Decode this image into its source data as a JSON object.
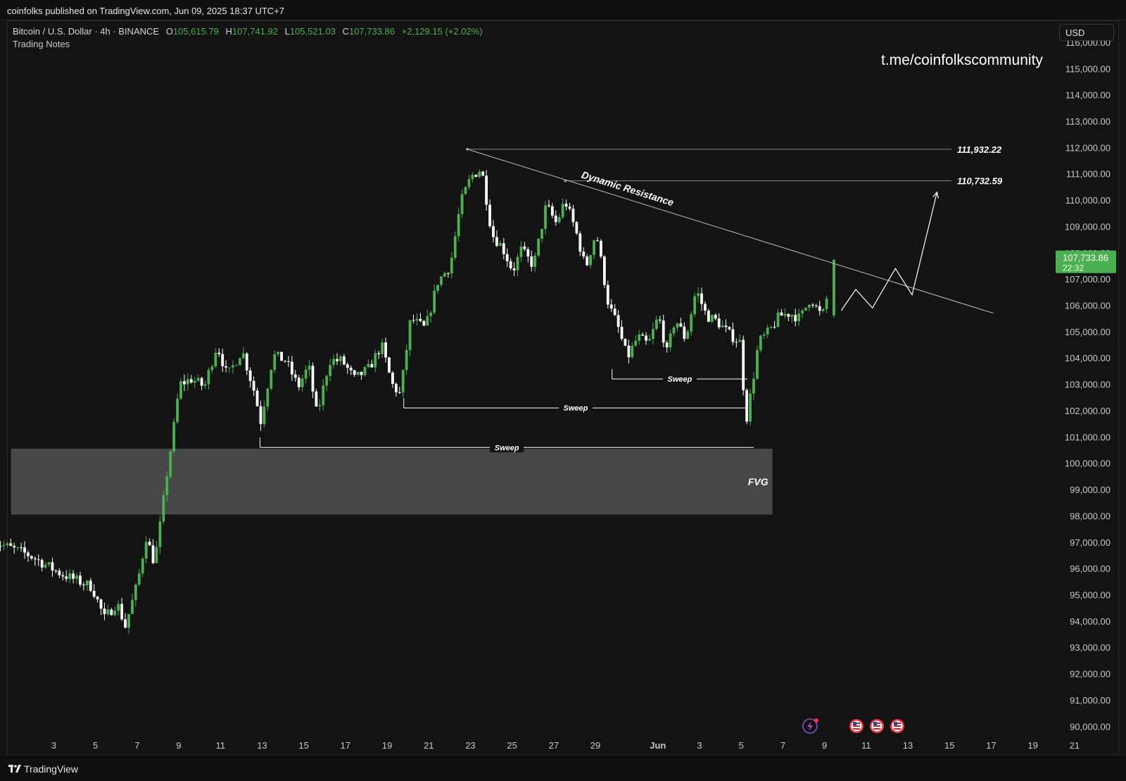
{
  "header": {
    "published": "coinfolks published on TradingView.com, Jun 09, 2025 18:37 UTC+7"
  },
  "legend": {
    "symbol": "Bitcoin / U.S. Dollar · 4h · BINANCE",
    "o_label": "O",
    "o_value": "105,615.79",
    "h_label": "H",
    "h_value": "107,741.92",
    "l_label": "L",
    "l_value": "105,521.03",
    "c_label": "C",
    "c_value": "107,733.86",
    "change": "+2,129.15 (+2.02%)",
    "notes": "Trading Notes"
  },
  "watermark": "t.me/coinfolkscommunity",
  "currency_button": "USD",
  "price_badge": {
    "price": "107,733.86",
    "countdown": "22:32",
    "color": "#4caf50"
  },
  "footer": {
    "brand": "TradingView"
  },
  "colors": {
    "up": "#4caf50",
    "down": "#ffffff",
    "fvg": "#474747",
    "background": "#131313"
  },
  "chart_data": {
    "type": "candlestick",
    "instrument": "Bitcoin / U.S. Dollar",
    "interval": "4h",
    "ylim": [
      89500,
      116800
    ],
    "y_ticks": [
      "116,000.00",
      "115,000.00",
      "114,000.00",
      "113,000.00",
      "112,000.00",
      "111,000.00",
      "110,000.00",
      "109,000.00",
      "108,000.00",
      "107,000.00",
      "106,000.00",
      "105,000.00",
      "104,000.00",
      "103,000.00",
      "102,000.00",
      "101,000.00",
      "100,000.00",
      "99,000.00",
      "98,000.00",
      "97,000.00",
      "96,000.00",
      "95,000.00",
      "94,000.00",
      "93,000.00",
      "92,000.00",
      "91,000.00",
      "90,000.00"
    ],
    "y_tick_values": [
      116000,
      115000,
      114000,
      113000,
      112000,
      111000,
      110000,
      109000,
      108000,
      107000,
      106000,
      105000,
      104000,
      103000,
      102000,
      101000,
      100000,
      99000,
      98000,
      97000,
      96000,
      95000,
      94000,
      93000,
      92000,
      91000,
      90000
    ],
    "x_ticks": [
      {
        "day": 3,
        "label": "3"
      },
      {
        "day": 5,
        "label": "5"
      },
      {
        "day": 7,
        "label": "7"
      },
      {
        "day": 9,
        "label": "9"
      },
      {
        "day": 11,
        "label": "11"
      },
      {
        "day": 13,
        "label": "13"
      },
      {
        "day": 15,
        "label": "15"
      },
      {
        "day": 17,
        "label": "17"
      },
      {
        "day": 19,
        "label": "19"
      },
      {
        "day": 21,
        "label": "21"
      },
      {
        "day": 23,
        "label": "23"
      },
      {
        "day": 25,
        "label": "25"
      },
      {
        "day": 27,
        "label": "27"
      },
      {
        "day": 29,
        "label": "29"
      },
      {
        "day": 32,
        "label": "Jun"
      },
      {
        "day": 34,
        "label": "3"
      },
      {
        "day": 36,
        "label": "5"
      },
      {
        "day": 38,
        "label": "7"
      },
      {
        "day": 40,
        "label": "9"
      },
      {
        "day": 42,
        "label": "11"
      },
      {
        "day": 44,
        "label": "13"
      },
      {
        "day": 46,
        "label": "15"
      },
      {
        "day": 48,
        "label": "17"
      },
      {
        "day": 50,
        "label": "19"
      },
      {
        "day": 52,
        "label": "21"
      }
    ],
    "swing_points": [
      [
        2.0,
        96500
      ],
      [
        3.5,
        95800
      ],
      [
        5.0,
        95300
      ],
      [
        5.6,
        94100
      ],
      [
        6.2,
        94700
      ],
      [
        6.6,
        93800
      ],
      [
        7.2,
        95500
      ],
      [
        7.6,
        97200
      ],
      [
        8.0,
        96200
      ],
      [
        8.3,
        97800
      ],
      [
        8.6,
        99600
      ],
      [
        8.9,
        101200
      ],
      [
        9.2,
        103000
      ],
      [
        9.8,
        103200
      ],
      [
        10.4,
        102900
      ],
      [
        11.0,
        104500
      ],
      [
        11.5,
        103300
      ],
      [
        12.2,
        104300
      ],
      [
        12.8,
        102700
      ],
      [
        13.1,
        101600
      ],
      [
        13.7,
        104100
      ],
      [
        14.3,
        103900
      ],
      [
        14.9,
        102900
      ],
      [
        15.4,
        103700
      ],
      [
        15.8,
        101800
      ],
      [
        16.4,
        103900
      ],
      [
        17.0,
        103900
      ],
      [
        17.6,
        103200
      ],
      [
        18.3,
        103600
      ],
      [
        18.9,
        104500
      ],
      [
        19.4,
        103000
      ],
      [
        19.8,
        102600
      ],
      [
        20.3,
        105500
      ],
      [
        21.0,
        105100
      ],
      [
        21.6,
        106900
      ],
      [
        22.2,
        107500
      ],
      [
        22.7,
        109900
      ],
      [
        23.2,
        110900
      ],
      [
        23.7,
        111200
      ],
      [
        24.2,
        108700
      ],
      [
        24.7,
        108200
      ],
      [
        25.2,
        107300
      ],
      [
        25.6,
        108100
      ],
      [
        26.2,
        107500
      ],
      [
        26.8,
        109800
      ],
      [
        27.3,
        109100
      ],
      [
        27.7,
        110000
      ],
      [
        28.2,
        108900
      ],
      [
        28.7,
        107400
      ],
      [
        29.2,
        108800
      ],
      [
        29.8,
        106000
      ],
      [
        30.2,
        105300
      ],
      [
        30.7,
        104000
      ],
      [
        31.2,
        104800
      ],
      [
        31.7,
        104500
      ],
      [
        32.2,
        105600
      ],
      [
        32.6,
        104200
      ],
      [
        33.0,
        105500
      ],
      [
        33.5,
        104700
      ],
      [
        34.0,
        106600
      ],
      [
        34.5,
        105600
      ],
      [
        35.0,
        105400
      ],
      [
        35.6,
        104900
      ],
      [
        36.1,
        104600
      ],
      [
        36.4,
        101600
      ],
      [
        36.7,
        103000
      ],
      [
        37.0,
        104600
      ],
      [
        37.5,
        105000
      ],
      [
        38.0,
        105600
      ],
      [
        38.5,
        105700
      ],
      [
        39.0,
        105500
      ],
      [
        39.5,
        106300
      ],
      [
        39.9,
        105700
      ],
      [
        40.2,
        105700
      ],
      [
        40.45,
        107733.86
      ]
    ],
    "annotations": [
      {
        "id": "level-111932",
        "type": "hline",
        "price": 111932.22,
        "label": "111,932.22"
      },
      {
        "id": "level-110732",
        "type": "hline",
        "price": 110732.59,
        "label": "110,732.59"
      },
      {
        "id": "dynamic-resistance",
        "type": "trendline",
        "label": "Dynamic Resistance",
        "from": [
          22.85,
          111932.22
        ],
        "to": [
          48.1,
          105700
        ]
      },
      {
        "id": "sweep-1",
        "type": "hline",
        "label": "Sweep",
        "price": 103200,
        "from_day": 29.8,
        "to_day": 36.3
      },
      {
        "id": "sweep-2",
        "type": "hline",
        "label": "Sweep",
        "price": 102100,
        "from_day": 19.8,
        "to_day": 36.3
      },
      {
        "id": "sweep-3",
        "type": "hline",
        "label": "Sweep",
        "price": 100600,
        "from_day": 12.9,
        "to_day": 36.6
      },
      {
        "id": "fvg-zone",
        "type": "zone",
        "label": "FVG",
        "price_top": 100550,
        "price_bottom": 98050,
        "from_day": 0.95,
        "to_day": 37.5
      },
      {
        "id": "projection",
        "type": "path",
        "points": [
          [
            40.8,
            105800
          ],
          [
            41.5,
            106600
          ],
          [
            42.3,
            105900
          ],
          [
            43.4,
            107400
          ],
          [
            44.2,
            106400
          ],
          [
            45.4,
            110300
          ]
        ]
      }
    ],
    "event_markers": [
      "flash-event-icon",
      "us-flag-icon",
      "us-flag-icon",
      "us-flag-icon"
    ]
  }
}
